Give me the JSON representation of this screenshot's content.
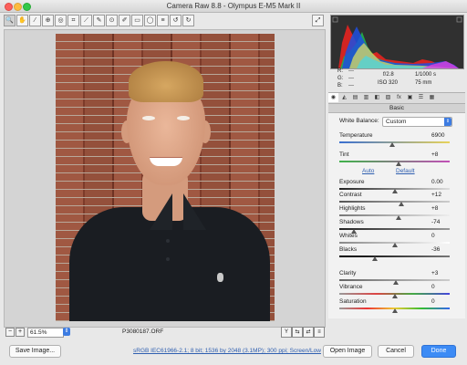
{
  "window": {
    "title": "Camera Raw 8.8  -  Olympus E-M5 Mark II"
  },
  "toolbar": {
    "tools": [
      {
        "name": "zoom-tool",
        "glyph": "🔍"
      },
      {
        "name": "hand-tool",
        "glyph": "✋"
      },
      {
        "name": "white-balance-tool",
        "glyph": "⁄"
      },
      {
        "name": "color-sampler-tool",
        "glyph": "⊕"
      },
      {
        "name": "targeted-adjustment-tool",
        "glyph": "◎"
      },
      {
        "name": "crop-tool",
        "glyph": "⌗"
      },
      {
        "name": "straighten-tool",
        "glyph": "⟋"
      },
      {
        "name": "spot-removal-tool",
        "glyph": "✎"
      },
      {
        "name": "red-eye-tool",
        "glyph": "⊙"
      },
      {
        "name": "adjustment-brush-tool",
        "glyph": "✐"
      },
      {
        "name": "graduated-filter-tool",
        "glyph": "▭"
      },
      {
        "name": "radial-filter-tool",
        "glyph": "◯"
      },
      {
        "name": "preferences-tool",
        "glyph": "≡"
      },
      {
        "name": "rotate-ccw-tool",
        "glyph": "↺"
      },
      {
        "name": "rotate-cw-tool",
        "glyph": "↻"
      }
    ],
    "preview_glyph": "⤢"
  },
  "readout": {
    "r": "R:",
    "g": "G:",
    "b": "B:",
    "dash": "---",
    "aperture": "f/2.8",
    "shutter": "1/1000 s",
    "iso": "ISO 320",
    "focal": "75 mm"
  },
  "panel_tabs": [
    "◉",
    "◭",
    "▤",
    "▥",
    "◧",
    "▨",
    "fx",
    "▣",
    "☰",
    "▦"
  ],
  "section": {
    "title": "Basic"
  },
  "white_balance": {
    "label": "White Balance:",
    "value": "Custom"
  },
  "links": {
    "auto": "Auto",
    "default": "Default"
  },
  "sliders": [
    {
      "key": "temperature",
      "label": "Temperature",
      "value": "6900",
      "pos": 0.48,
      "track": "linear-gradient(90deg,#3a6fd0,#e8d35a)"
    },
    {
      "key": "tint",
      "label": "Tint",
      "value": "+8",
      "pos": 0.54,
      "track": "linear-gradient(90deg,#3fb24a,#c24fb7)"
    },
    {
      "key": "exposure",
      "label": "Exposure",
      "value": "0.00",
      "pos": 0.5,
      "track": "linear-gradient(90deg,#222,#ddd)"
    },
    {
      "key": "contrast",
      "label": "Contrast",
      "value": "+12",
      "pos": 0.56,
      "track": "linear-gradient(90deg,#555,#ccc)"
    },
    {
      "key": "highlights",
      "label": "Highlights",
      "value": "+8",
      "pos": 0.54,
      "track": "linear-gradient(90deg,#777,#eee)"
    },
    {
      "key": "shadows",
      "label": "Shadows",
      "value": "-74",
      "pos": 0.13,
      "track": "linear-gradient(90deg,#222,#999)"
    },
    {
      "key": "whites",
      "label": "Whites",
      "value": "0",
      "pos": 0.5,
      "track": "linear-gradient(90deg,#888,#fff)"
    },
    {
      "key": "blacks",
      "label": "Blacks",
      "value": "-36",
      "pos": 0.32,
      "track": "linear-gradient(90deg,#000,#777)"
    },
    {
      "key": "clarity",
      "label": "Clarity",
      "value": "+3",
      "pos": 0.515,
      "track": "linear-gradient(90deg,#666,#ccc)"
    },
    {
      "key": "vibrance",
      "label": "Vibrance",
      "value": "0",
      "pos": 0.5,
      "track": "linear-gradient(90deg,#999,#d44,#4a4,#44d)"
    },
    {
      "key": "saturation",
      "label": "Saturation",
      "value": "0",
      "pos": 0.5,
      "track": "linear-gradient(90deg,#999,#e33,#ec3,#3b3,#36e)"
    }
  ],
  "status": {
    "zoom": "61.5%",
    "filename": "P3080187.ORF",
    "minus": "−",
    "plus": "+"
  },
  "bottom": {
    "save": "Save Image...",
    "info": "sRGB IEC61966-2.1; 8 bit; 1536 by 2048 (3.1MP); 300 ppi; Screen/Low",
    "open": "Open Image",
    "cancel": "Cancel",
    "done": "Done"
  },
  "colors": {
    "accent": "#3c8bf5",
    "histogram_bg": "#303030"
  }
}
